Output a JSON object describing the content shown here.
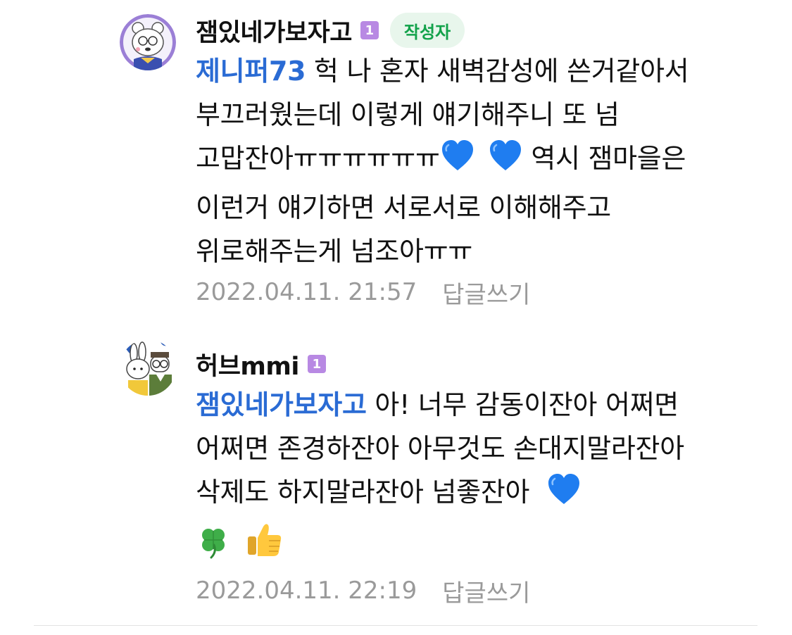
{
  "comments": [
    {
      "nickname": "잼있네가보자고",
      "level": "1",
      "writer_badge": "작성자",
      "mention": "제니퍼73",
      "text": " 헉 나 혼자 새벽감성에 쓴거같아서 부끄러웠는데 이렇게 얘기해주니 또 넘 고맙잔아ㅠㅠㅠㅠㅠㅠ",
      "text_after_emoji": " 역시 잼마을은 이런거 얘기하면 서로서로 이해해주고 위로해주는게 넘조아ㅠㅠ",
      "emojis": [
        "blue-heart",
        "blue-heart"
      ],
      "timestamp": "2022.04.11. 21:57",
      "reply_label": "답글쓰기"
    },
    {
      "nickname": "허브mmi",
      "level": "1",
      "mention": "잼있네가보자고",
      "text": " 아! 너무 감동이잔아 어쩌면 어쩌면 존경하잔아 아무것도 손대지말라잔아 삭제도 하지말라잔아 넘좋잔아 ",
      "emojis": [
        "blue-heart",
        "four-leaf-clover",
        "thumbs-up"
      ],
      "timestamp": "2022.04.11. 22:19",
      "reply_label": "답글쓰기"
    }
  ],
  "colors": {
    "mention": "#2a6bd4",
    "writer_badge_bg": "#e8f6ec",
    "writer_badge_text": "#12a24a",
    "level_badge": "#b889e3",
    "meta_text": "#9a9a9a",
    "heart": "#1f7df0"
  }
}
